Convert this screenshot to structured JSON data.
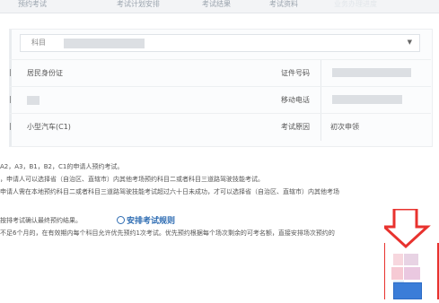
{
  "tabs": [
    "预约考试",
    "考试计划安排",
    "考试结果",
    "考试资料",
    "业务办理进度"
  ],
  "form": {
    "subject_label": "科目",
    "dropdown_icon": "triangle-down-icon",
    "rows": [
      {
        "left": "居民身份证",
        "right_label": "证件号码"
      },
      {
        "left": "",
        "right_label": "移动电话"
      },
      {
        "left": "小型汽车(C1)",
        "right_label": "考试原因",
        "right_value": "初次申领"
      }
    ]
  },
  "notices": [
    "A2，A3，B1，B2，C1的申请人预约考试。",
    "，申请人可以选择省（自治区、直辖市）内其他考场预约科目二或者科目三道路驾驶技能考试。",
    "申请人需在本地预约科目二或者科目三道路驾驶技能考试超过六十日未成功，才可以选择省（自治区、直辖市）内其他考场"
  ],
  "arrangement_text": "按排考试确认最终预约结果。",
  "rules_link": "安排考试规则",
  "notice_2": "不足6个月的，在有效期内每个科目允许优先预约1次考试。优先预约根据每个场次剩余的可考名额，直接安排场次预约的",
  "colors": {
    "link": "#2f6db3",
    "arrow": "#e8322e",
    "button": "#3b7dd8"
  }
}
